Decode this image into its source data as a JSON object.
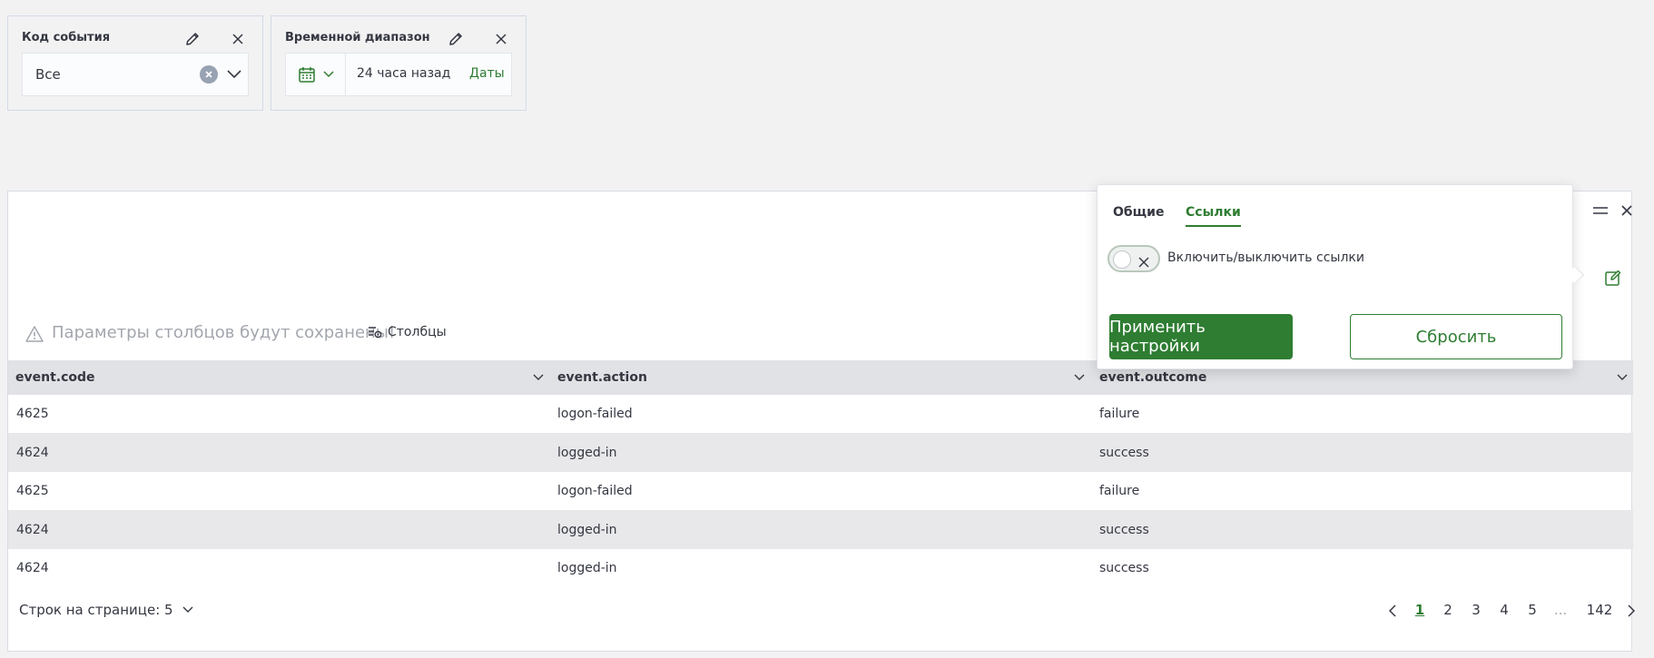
{
  "filters": {
    "event_code": {
      "title": "Код события",
      "value": "Все"
    },
    "time_range": {
      "title": "Временной диапазон",
      "value": "24 часа назад",
      "dates_link": "Даты"
    }
  },
  "toolbar": {
    "warning": "Параметры столбцов будут сохранены!",
    "columns_button": "Столбцы"
  },
  "table": {
    "columns": [
      "event.code",
      "event.action",
      "event.outcome"
    ],
    "rows": [
      [
        "4625",
        "logon-failed",
        "failure"
      ],
      [
        "4624",
        "logged-in",
        "success"
      ],
      [
        "4625",
        "logon-failed",
        "failure"
      ],
      [
        "4624",
        "logged-in",
        "success"
      ],
      [
        "4624",
        "logged-in",
        "success"
      ]
    ]
  },
  "pagination": {
    "rows_per_page": "Строк на странице: 5",
    "pages": [
      "1",
      "2",
      "3",
      "4",
      "5",
      "...",
      "142"
    ],
    "current_page": "1"
  },
  "popover": {
    "tabs": [
      "Общие",
      "Ссылки"
    ],
    "active_tab": "Ссылки",
    "toggle_label": "Включить/выключить ссылки",
    "toggle_on": false,
    "apply_button": "Применить настройки",
    "reset_button": "Сбросить"
  },
  "colors": {
    "accent": "#2e7d32",
    "background": "#f2f2f3",
    "header_row": "#e1e2e5",
    "alt_row": "#e8e8ea"
  },
  "icons": [
    "pencil-icon",
    "close-icon",
    "clear-icon",
    "chevron-down-icon",
    "calendar-icon",
    "warning-icon",
    "columns-icon",
    "menu-icon",
    "edit-icon",
    "chevron-left-icon",
    "chevron-right-icon"
  ]
}
